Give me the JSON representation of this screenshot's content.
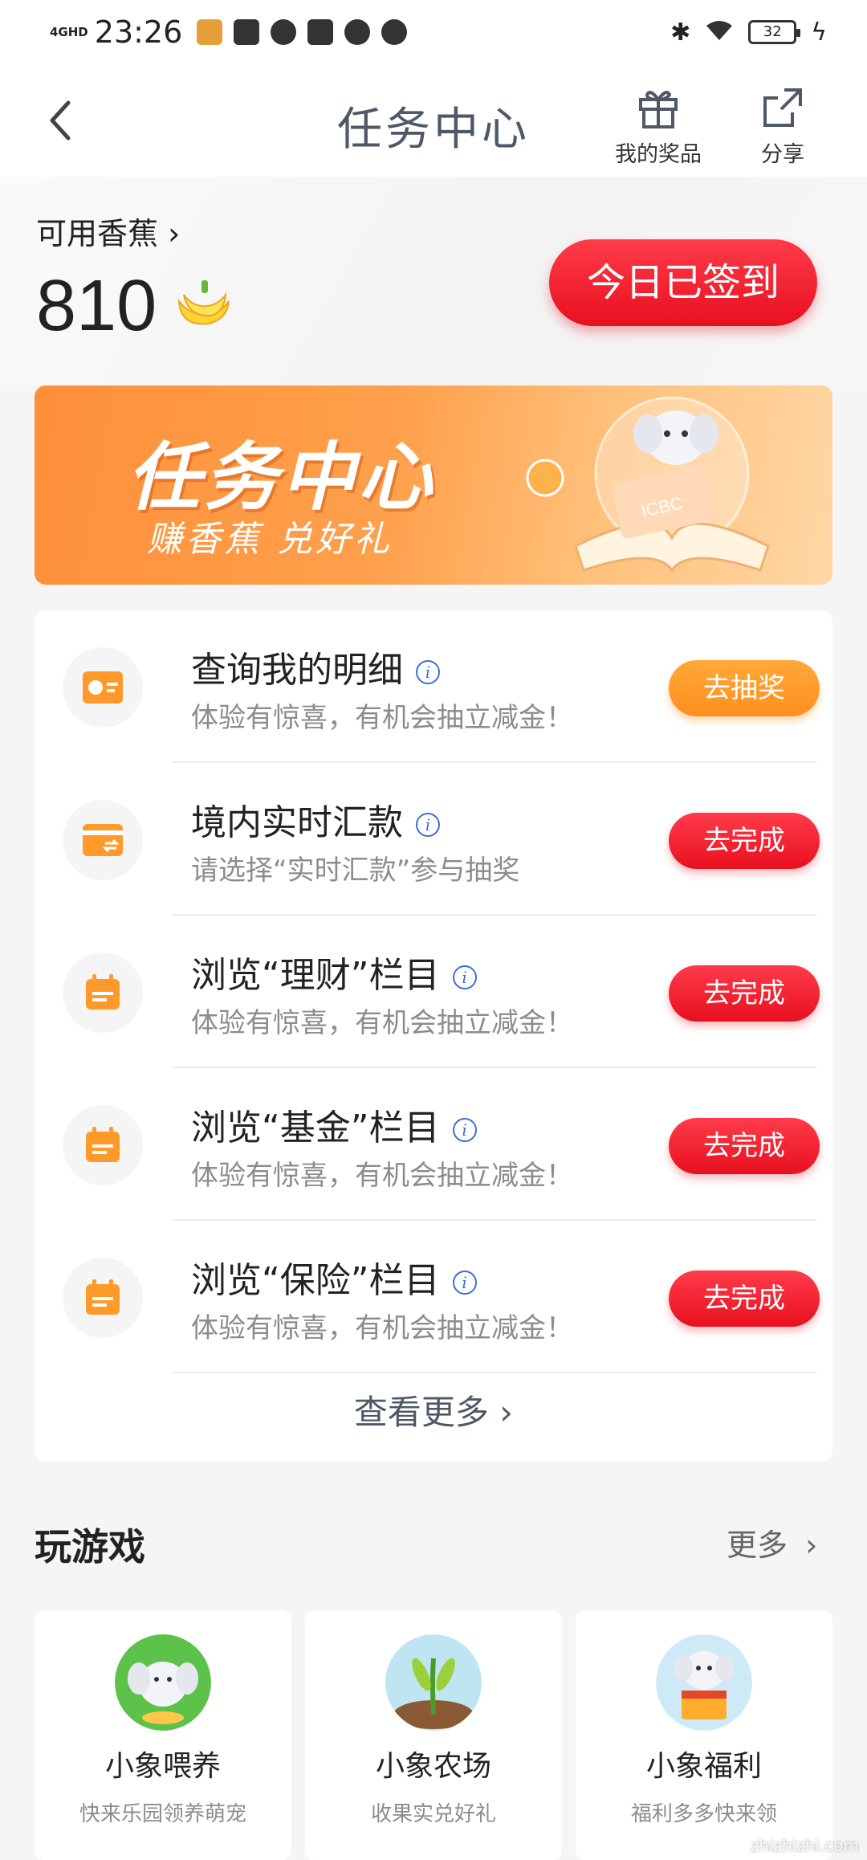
{
  "status_bar": {
    "network": "4GHD",
    "time": "23:26",
    "battery": "32"
  },
  "header": {
    "back_icon": "chevron-left-icon",
    "title": "任务中心",
    "prizes_label": "我的奖品",
    "share_label": "分享"
  },
  "balance": {
    "label": "可用香蕉",
    "value": "810",
    "signed_label": "今日已签到"
  },
  "banner": {
    "title": "任务中心",
    "subtitle": "赚香蕉 兑好礼",
    "badge": "ICBC"
  },
  "tasks": [
    {
      "title": "查询我的明细",
      "subtitle": "体验有惊喜，有机会抽立减金！",
      "button": "去抽奖",
      "icon": "chart-card-icon"
    },
    {
      "title": "境内实时汇款",
      "subtitle": "请选择“实时汇款”参与抽奖",
      "button": "去完成",
      "icon": "transfer-card-icon"
    },
    {
      "title": "浏览“理财”栏目",
      "subtitle": "体验有惊喜，有机会抽立减金！",
      "button": "去完成",
      "icon": "calendar-icon"
    },
    {
      "title": "浏览“基金”栏目",
      "subtitle": "体验有惊喜，有机会抽立减金！",
      "button": "去完成",
      "icon": "calendar-icon"
    },
    {
      "title": "浏览“保险”栏目",
      "subtitle": "体验有惊喜，有机会抽立减金！",
      "button": "去完成",
      "icon": "calendar-icon"
    }
  ],
  "see_more": "查看更多",
  "games": {
    "title": "玩游戏",
    "more": "更多",
    "items": [
      {
        "name": "小象喂养",
        "desc": "快来乐园领养萌宠"
      },
      {
        "name": "小象农场",
        "desc": "收果实兑好礼"
      },
      {
        "name": "小象福利",
        "desc": "福利多多快来领"
      }
    ]
  },
  "watermark": "zhizhizhi.com",
  "colors": {
    "accent_red": "#e8101f",
    "accent_orange": "#ff8f1f",
    "title_gray": "#4f5866"
  }
}
